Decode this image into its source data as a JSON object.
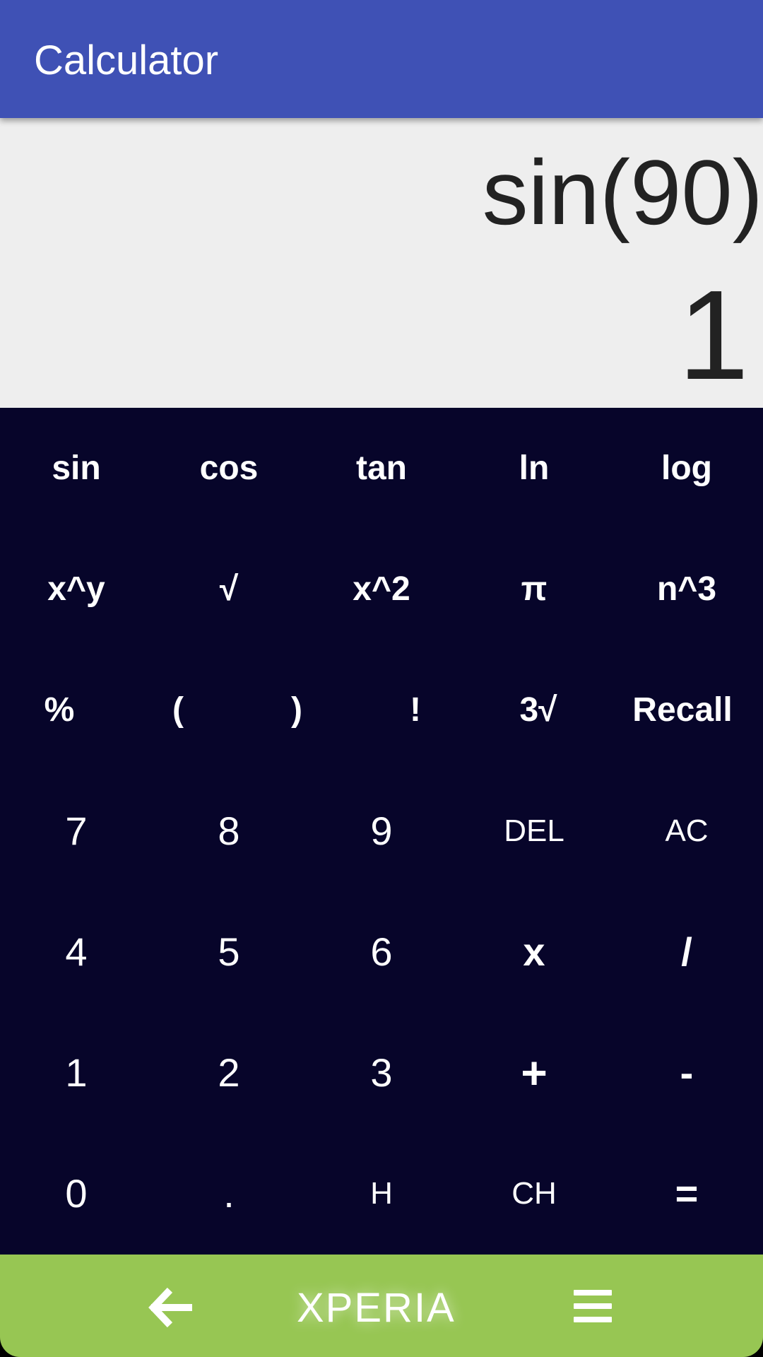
{
  "app_bar": {
    "title": "Calculator"
  },
  "display": {
    "expression": "sin(90)",
    "result": "1"
  },
  "keypad": {
    "sin": "sin",
    "cos": "cos",
    "tan": "tan",
    "ln": "ln",
    "log": "log",
    "power": "x^y",
    "sqrt": "√",
    "square": "x^2",
    "pi": "π",
    "cube": "n^3",
    "percent": "%",
    "open_paren": "(",
    "close_paren": ")",
    "factorial": "!",
    "cbrt": "3√",
    "recall": "Recall",
    "d7": "7",
    "d8": "8",
    "d9": "9",
    "del": "DEL",
    "ac": "AC",
    "d4": "4",
    "d5": "5",
    "d6": "6",
    "multiply": "x",
    "divide": "/",
    "d1": "1",
    "d2": "2",
    "d3": "3",
    "plus": "+",
    "minus": "-",
    "d0": "0",
    "decimal": ".",
    "history": "H",
    "clear_history": "CH",
    "equals": "="
  },
  "nav_bar": {
    "logo": "XPERIA"
  },
  "colors": {
    "app_bar": "#3f51b5",
    "display_bg": "#eeeeee",
    "keypad_bg": "#07052a",
    "nav_bar": "#97c653"
  }
}
